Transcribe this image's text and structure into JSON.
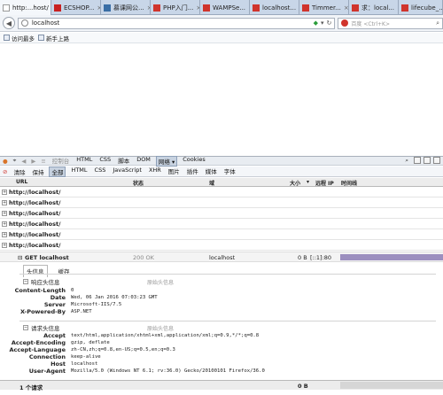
{
  "browser": {
    "tabs": [
      {
        "label": "http:...host/",
        "active": true,
        "favicon": "blank-page-icon",
        "color": "#f4f7fb"
      },
      {
        "label": "ECSHOP...",
        "active": false,
        "favicon": "ecshop-icon",
        "color": "#c82020"
      },
      {
        "label": "慕课网公...",
        "active": false,
        "favicon": "imooc-icon",
        "color": "#3a6ea5"
      },
      {
        "label": "PHP入门...",
        "active": false,
        "favicon": "red-flag-icon",
        "color": "#d0342c"
      },
      {
        "label": "WAMPSe...",
        "active": false,
        "favicon": "red-flag-icon",
        "color": "#d0342c"
      },
      {
        "label": "localhost...",
        "active": false,
        "favicon": "red-flag-icon",
        "color": "#d0342c"
      },
      {
        "label": "Timmer...",
        "active": false,
        "favicon": "red-flag-icon",
        "color": "#d0342c"
      },
      {
        "label": "求：local...",
        "active": false,
        "favicon": "red-flag-icon",
        "color": "#d0342c"
      },
      {
        "label": "lifecube_...",
        "active": false,
        "favicon": "red-flag-icon",
        "color": "#d0342c"
      }
    ],
    "url": "localhost",
    "search_placeholder": "百度 <Ctrl+K>",
    "bookmarks": [
      "访问最多",
      "新手上路"
    ]
  },
  "firebug": {
    "toolbar": {
      "items": [
        "控制台",
        "HTML",
        "CSS",
        "脚本",
        "DOM",
        "网络 ▾",
        "Cookies"
      ],
      "active_index": 5
    },
    "filter": {
      "left": [
        "清除",
        "保持"
      ],
      "types": [
        "全部",
        "HTML",
        "CSS",
        "JavaScript",
        "XHR",
        "图片",
        "插件",
        "媒体",
        "字体"
      ],
      "active_index": 0
    },
    "columns": {
      "url": "URL",
      "status": "状态",
      "domain": "域",
      "size": "大小",
      "remote_ip": "远程 IP",
      "timeline": "时间线"
    },
    "requests": [
      "http://localhost/",
      "http://localhost/",
      "http://localhost/",
      "http://localhost/",
      "http://localhost/",
      "http://localhost/"
    ],
    "expanded": {
      "method_url": "GET localhost",
      "status": "200 OK",
      "domain": "localhost",
      "size": "0 B",
      "remote_ip": "[::1]:80",
      "detail_tabs": [
        "头信息",
        "缓存"
      ],
      "response_section": "响应头信息",
      "request_section": "请求头信息",
      "view_source": "原始头信息",
      "response_headers": [
        {
          "k": "Content-Length",
          "v": "0"
        },
        {
          "k": "Date",
          "v": "Wed, 06 Jan 2016 07:03:23 GMT"
        },
        {
          "k": "Server",
          "v": "Microsoft-IIS/7.5"
        },
        {
          "k": "X-Powered-By",
          "v": "ASP.NET"
        }
      ],
      "request_headers": [
        {
          "k": "Accept",
          "v": "text/html,application/xhtml+xml,application/xml;q=0.9,*/*;q=0.8"
        },
        {
          "k": "Accept-Encoding",
          "v": "gzip, deflate"
        },
        {
          "k": "Accept-Language",
          "v": "zh-CN,zh;q=0.8,en-US;q=0.5,en;q=0.3"
        },
        {
          "k": "Connection",
          "v": "keep-alive"
        },
        {
          "k": "Host",
          "v": "localhost"
        },
        {
          "k": "User-Agent",
          "v": "Mozilla/5.0 (Windows NT 6.1; rv:36.0) Gecko/20100101 Firefox/36.0"
        }
      ]
    },
    "footer": {
      "count": "1 个请求",
      "size": "0 B"
    }
  }
}
